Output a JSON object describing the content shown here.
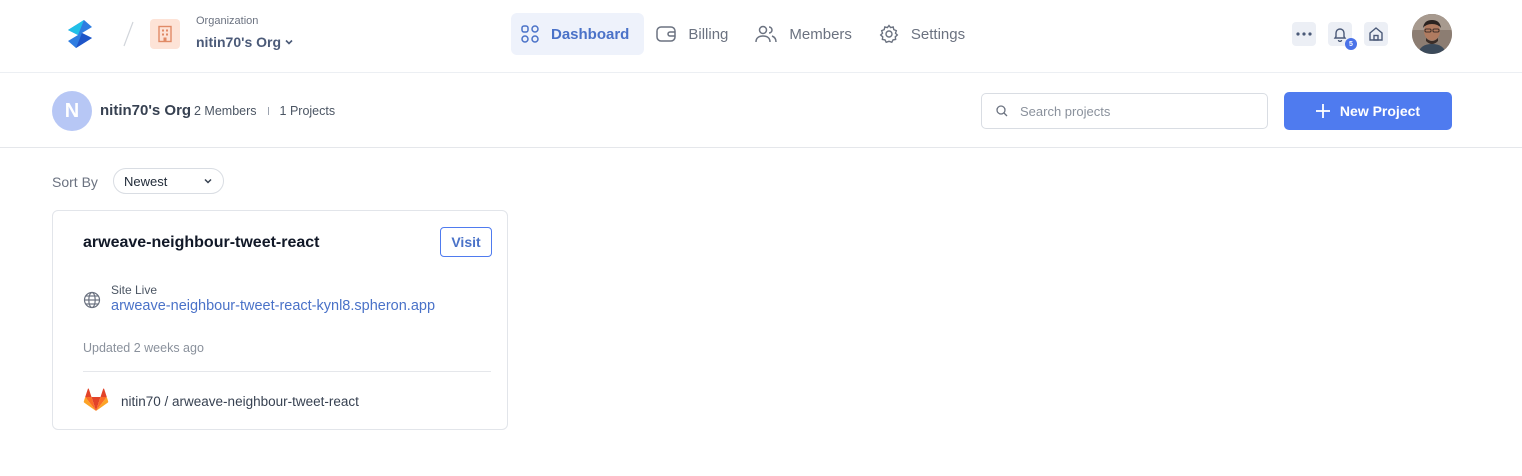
{
  "header": {
    "org_label": "Organization",
    "org_name": "nitin70's Org",
    "nav": [
      {
        "label": "Dashboard",
        "icon": "grid-icon",
        "active": true
      },
      {
        "label": "Billing",
        "icon": "wallet-icon",
        "active": false
      },
      {
        "label": "Members",
        "icon": "users-icon",
        "active": false
      },
      {
        "label": "Settings",
        "icon": "gear-icon",
        "active": false
      }
    ],
    "notification_count": "5"
  },
  "subheader": {
    "avatar_letter": "N",
    "org_name": "nitin70's Org",
    "members": "2 Members",
    "projects": "1 Projects",
    "search_placeholder": "Search projects",
    "new_project_label": "New Project"
  },
  "sort": {
    "label": "Sort By",
    "selected": "Newest"
  },
  "projects": [
    {
      "name": "arweave-neighbour-tweet-react",
      "visit_label": "Visit",
      "status": "Site Live",
      "url": "arweave-neighbour-tweet-react-kynl8.spheron.app",
      "updated": "Updated 2 weeks ago",
      "repo": "nitin70 / arweave-neighbour-tweet-react"
    }
  ],
  "colors": {
    "accent": "#4f7bef",
    "link": "#4a72c8",
    "active_nav_bg": "#eef2fb"
  }
}
